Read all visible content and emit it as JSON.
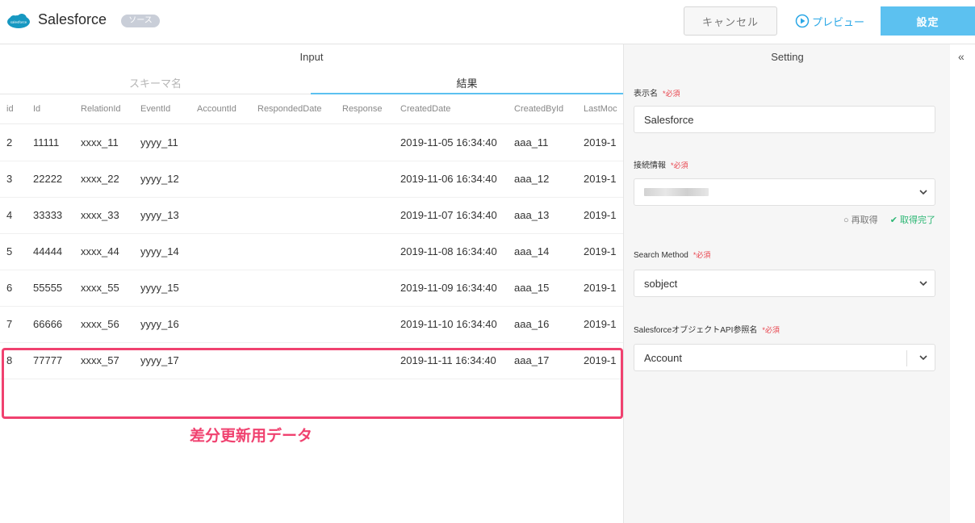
{
  "header": {
    "app_name": "Salesforce",
    "tag": "ソース",
    "cancel_label": "キャンセル",
    "preview_label": "プレビュー",
    "setting_label": "設定"
  },
  "left": {
    "title": "Input",
    "tabs": [
      {
        "label": "スキーマ名",
        "active": false
      },
      {
        "label": "結果",
        "active": true
      }
    ],
    "columns": [
      "id",
      "Id",
      "RelationId",
      "EventId",
      "AccountId",
      "RespondedDate",
      "Response",
      "CreatedDate",
      "CreatedById",
      "LastMoc"
    ],
    "rows": [
      [
        "2",
        "11111",
        "xxxx_11",
        "yyyy_11",
        "",
        "",
        "",
        "2019-11-05 16:34:40",
        "aaa_11",
        "2019-1"
      ],
      [
        "3",
        "22222",
        "xxxx_22",
        "yyyy_12",
        "",
        "",
        "",
        "2019-11-06 16:34:40",
        "aaa_12",
        "2019-1"
      ],
      [
        "4",
        "33333",
        "xxxx_33",
        "yyyy_13",
        "",
        "",
        "",
        "2019-11-07 16:34:40",
        "aaa_13",
        "2019-1"
      ],
      [
        "5",
        "44444",
        "xxxx_44",
        "yyyy_14",
        "",
        "",
        "",
        "2019-11-08 16:34:40",
        "aaa_14",
        "2019-1"
      ],
      [
        "6",
        "55555",
        "xxxx_55",
        "yyyy_15",
        "",
        "",
        "",
        "2019-11-09 16:34:40",
        "aaa_15",
        "2019-1"
      ],
      [
        "7",
        "66666",
        "xxxx_56",
        "yyyy_16",
        "",
        "",
        "",
        "2019-11-10 16:34:40",
        "aaa_16",
        "2019-1"
      ],
      [
        "8",
        "77777",
        "xxxx_57",
        "yyyy_17",
        "",
        "",
        "",
        "2019-11-11 16:34:40",
        "aaa_17",
        "2019-1"
      ]
    ],
    "annotation": "差分更新用データ"
  },
  "right": {
    "title": "Setting",
    "display_name_label": "表示名",
    "display_name_value": "Salesforce",
    "connection_label": "接続情報",
    "refresh_label": "再取得",
    "fetched_label": "取得完了",
    "search_method_label": "Search Method",
    "search_method_value": "sobject",
    "object_label": "SalesforceオブジェクトAPI参照名",
    "object_value": "Account",
    "required_mark": "*必須"
  },
  "colors": {
    "accent": "#5cc1f0",
    "highlight": "#f0416f",
    "success": "#2bb673",
    "required": "#e8414b"
  },
  "icons": [
    "salesforce-cloud-icon",
    "play-circle-icon",
    "chevron-down-icon",
    "refresh-icon",
    "check-circle-icon",
    "collapse-double-chevron-icon"
  ]
}
